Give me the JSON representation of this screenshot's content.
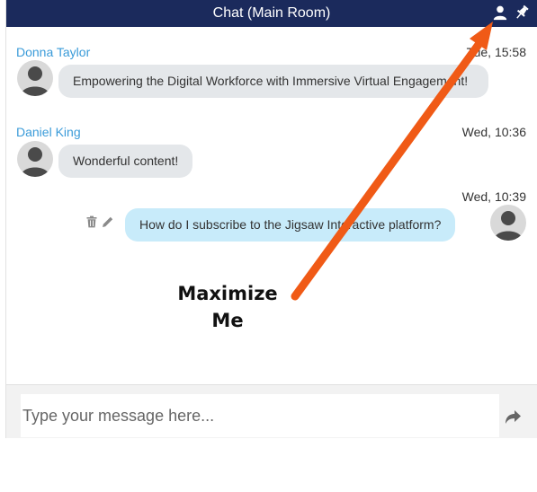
{
  "header": {
    "title": "Chat (Main Room)",
    "icons": [
      "user-icon",
      "pin-icon"
    ]
  },
  "messages": [
    {
      "sender": "Donna Taylor",
      "time": "Tue, 15:58",
      "text": "Empowering the Digital Workforce with Immersive Virtual Engagement!",
      "direction": "in"
    },
    {
      "sender": "Daniel King",
      "time": "Wed, 10:36",
      "text": "Wonderful content!",
      "direction": "in"
    },
    {
      "sender": "",
      "time": "Wed, 10:39",
      "text": "How do I subscribe to the Jigsaw Interactive platform?",
      "direction": "out"
    }
  ],
  "composer": {
    "placeholder": "Type your message here...",
    "value": ""
  },
  "annotation": {
    "line1": "Maximize",
    "line2": "Me"
  },
  "colors": {
    "header_bg": "#1b2a5c",
    "sender_name": "#3a9bd9",
    "bubble_in": "#e4e7ea",
    "bubble_out": "#c8ebfa",
    "arrow": "#f05a16"
  }
}
